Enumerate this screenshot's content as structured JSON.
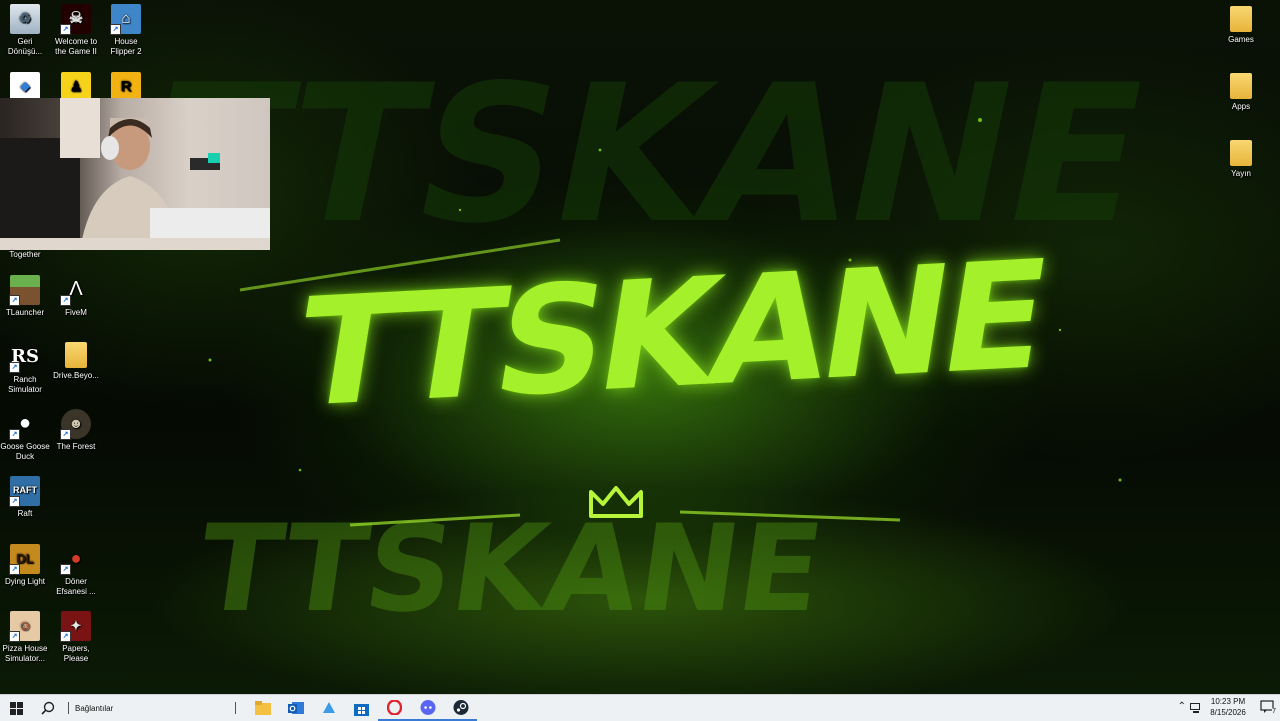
{
  "desktop": {
    "left_icons": [
      {
        "label": "Geri\nDönüşü...",
        "icon": "recycle-bin-icon"
      },
      {
        "label": "Welcome to\nthe Game II",
        "icon": "skull-game-icon"
      },
      {
        "label": "House\nFlipper 2",
        "icon": "house-flipper-icon"
      },
      {
        "label": "",
        "icon": "shortcut-app-icon"
      },
      {
        "label": "",
        "icon": "yellow-app-icon"
      },
      {
        "label": "",
        "icon": "rockstar-icon"
      },
      {
        "label": "Together",
        "icon": "together-game-icon"
      },
      {
        "label": "TLauncher",
        "icon": "minecraft-block-icon"
      },
      {
        "label": "FiveM",
        "icon": "fivem-icon"
      },
      {
        "label": "Ranch\nSimulator",
        "icon": "ranch-simulator-icon"
      },
      {
        "label": "Drive.Beyo...",
        "icon": "folder-icon"
      },
      {
        "label": "Goose Goose\nDuck",
        "icon": "goose-icon"
      },
      {
        "label": "The Forest",
        "icon": "the-forest-icon"
      },
      {
        "label": "Raft",
        "icon": "raft-icon"
      },
      {
        "label": "Dying Light",
        "icon": "dying-light-icon"
      },
      {
        "label": "Döner\nEfsanesi ...",
        "icon": "doner-icon"
      },
      {
        "label": "Pizza House\nSimulator...",
        "icon": "pizza-house-icon"
      },
      {
        "label": "Papers,\nPlease",
        "icon": "papers-please-icon"
      }
    ],
    "right_icons": [
      {
        "label": "Games",
        "icon": "folder-icon"
      },
      {
        "label": "Apps",
        "icon": "folder-icon"
      },
      {
        "label": "Yayın",
        "icon": "folder-icon"
      }
    ]
  },
  "wallpaper": {
    "logo_text": "TTSKANE",
    "accent_color": "#8fe01a"
  },
  "taskbar": {
    "toolbar_label": "Bağlantılar",
    "time": "10:23 PM",
    "date": "8/15/2026",
    "notification_count": "7",
    "apps": [
      "file-explorer-icon",
      "outlook-icon",
      "edge-icon",
      "store-icon",
      "opera-icon",
      "discord-icon",
      "steam-icon"
    ]
  }
}
